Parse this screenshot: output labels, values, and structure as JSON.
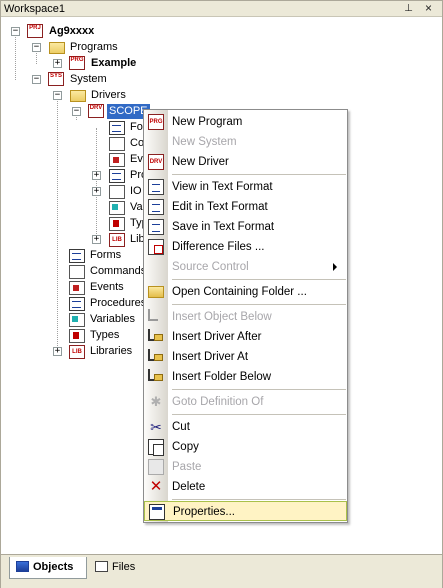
{
  "window": {
    "title": "Workspace1",
    "pin_icon": "pin-icon",
    "close_icon": "close-icon"
  },
  "tree": {
    "root": "Ag9xxxx",
    "programs": "Programs",
    "example": "Example",
    "system": "System",
    "drivers": "Drivers",
    "scope": "SCOPE",
    "scope_children": [
      "Fo",
      "Co",
      "Ev",
      "Pro",
      "IO",
      "Va",
      "Typ",
      "Lib"
    ],
    "system_children": [
      "Forms",
      "Commands",
      "Events",
      "Procedures",
      "Variables",
      "Types",
      "Libraries"
    ],
    "icon_tags": {
      "prj": "PRJ",
      "prg": "PRG",
      "sys": "SYS",
      "drv": "DRV",
      "lib": "LIB"
    }
  },
  "context_menu": {
    "items": [
      {
        "label": "New Program",
        "icon": "new-program-icon",
        "enabled": true
      },
      {
        "label": "New System",
        "icon": "new-system-icon",
        "enabled": false
      },
      {
        "label": "New Driver",
        "icon": "new-driver-icon",
        "enabled": true
      },
      {
        "label": "View in Text Format",
        "icon": "view-text-icon",
        "enabled": true
      },
      {
        "label": "Edit in Text Format",
        "icon": "edit-text-icon",
        "enabled": true
      },
      {
        "label": "Save in Text Format",
        "icon": "save-text-icon",
        "enabled": true
      },
      {
        "label": "Difference Files ...",
        "icon": "difference-files-icon",
        "enabled": true
      },
      {
        "label": "Source Control",
        "icon": "source-control-icon",
        "enabled": false,
        "submenu": true
      },
      {
        "label": "Open Containing Folder ...",
        "icon": "folder-icon",
        "enabled": true
      },
      {
        "label": "Insert Object Below",
        "icon": "insert-object-icon",
        "enabled": false
      },
      {
        "label": "Insert Driver After",
        "icon": "insert-driver-after-icon",
        "enabled": true
      },
      {
        "label": "Insert Driver At",
        "icon": "insert-driver-at-icon",
        "enabled": true
      },
      {
        "label": "Insert Folder Below",
        "icon": "insert-folder-icon",
        "enabled": true
      },
      {
        "label": "Goto Definition Of",
        "icon": "goto-definition-icon",
        "enabled": false
      },
      {
        "label": "Cut",
        "icon": "scissors-icon",
        "enabled": true
      },
      {
        "label": "Copy",
        "icon": "copy-icon",
        "enabled": true
      },
      {
        "label": "Paste",
        "icon": "paste-icon",
        "enabled": false
      },
      {
        "label": "Delete",
        "icon": "delete-icon",
        "enabled": true
      },
      {
        "label": "Properties...",
        "icon": "properties-icon",
        "enabled": true,
        "highlighted": true
      }
    ]
  },
  "tabs": [
    {
      "label": "Objects",
      "icon": "objects-icon",
      "active": true
    },
    {
      "label": "Files",
      "icon": "files-icon",
      "active": false
    }
  ],
  "colors": {
    "selection": "#316ac5",
    "menu_highlight": "#fff3c4",
    "disabled_text": "#a7a6aa"
  }
}
